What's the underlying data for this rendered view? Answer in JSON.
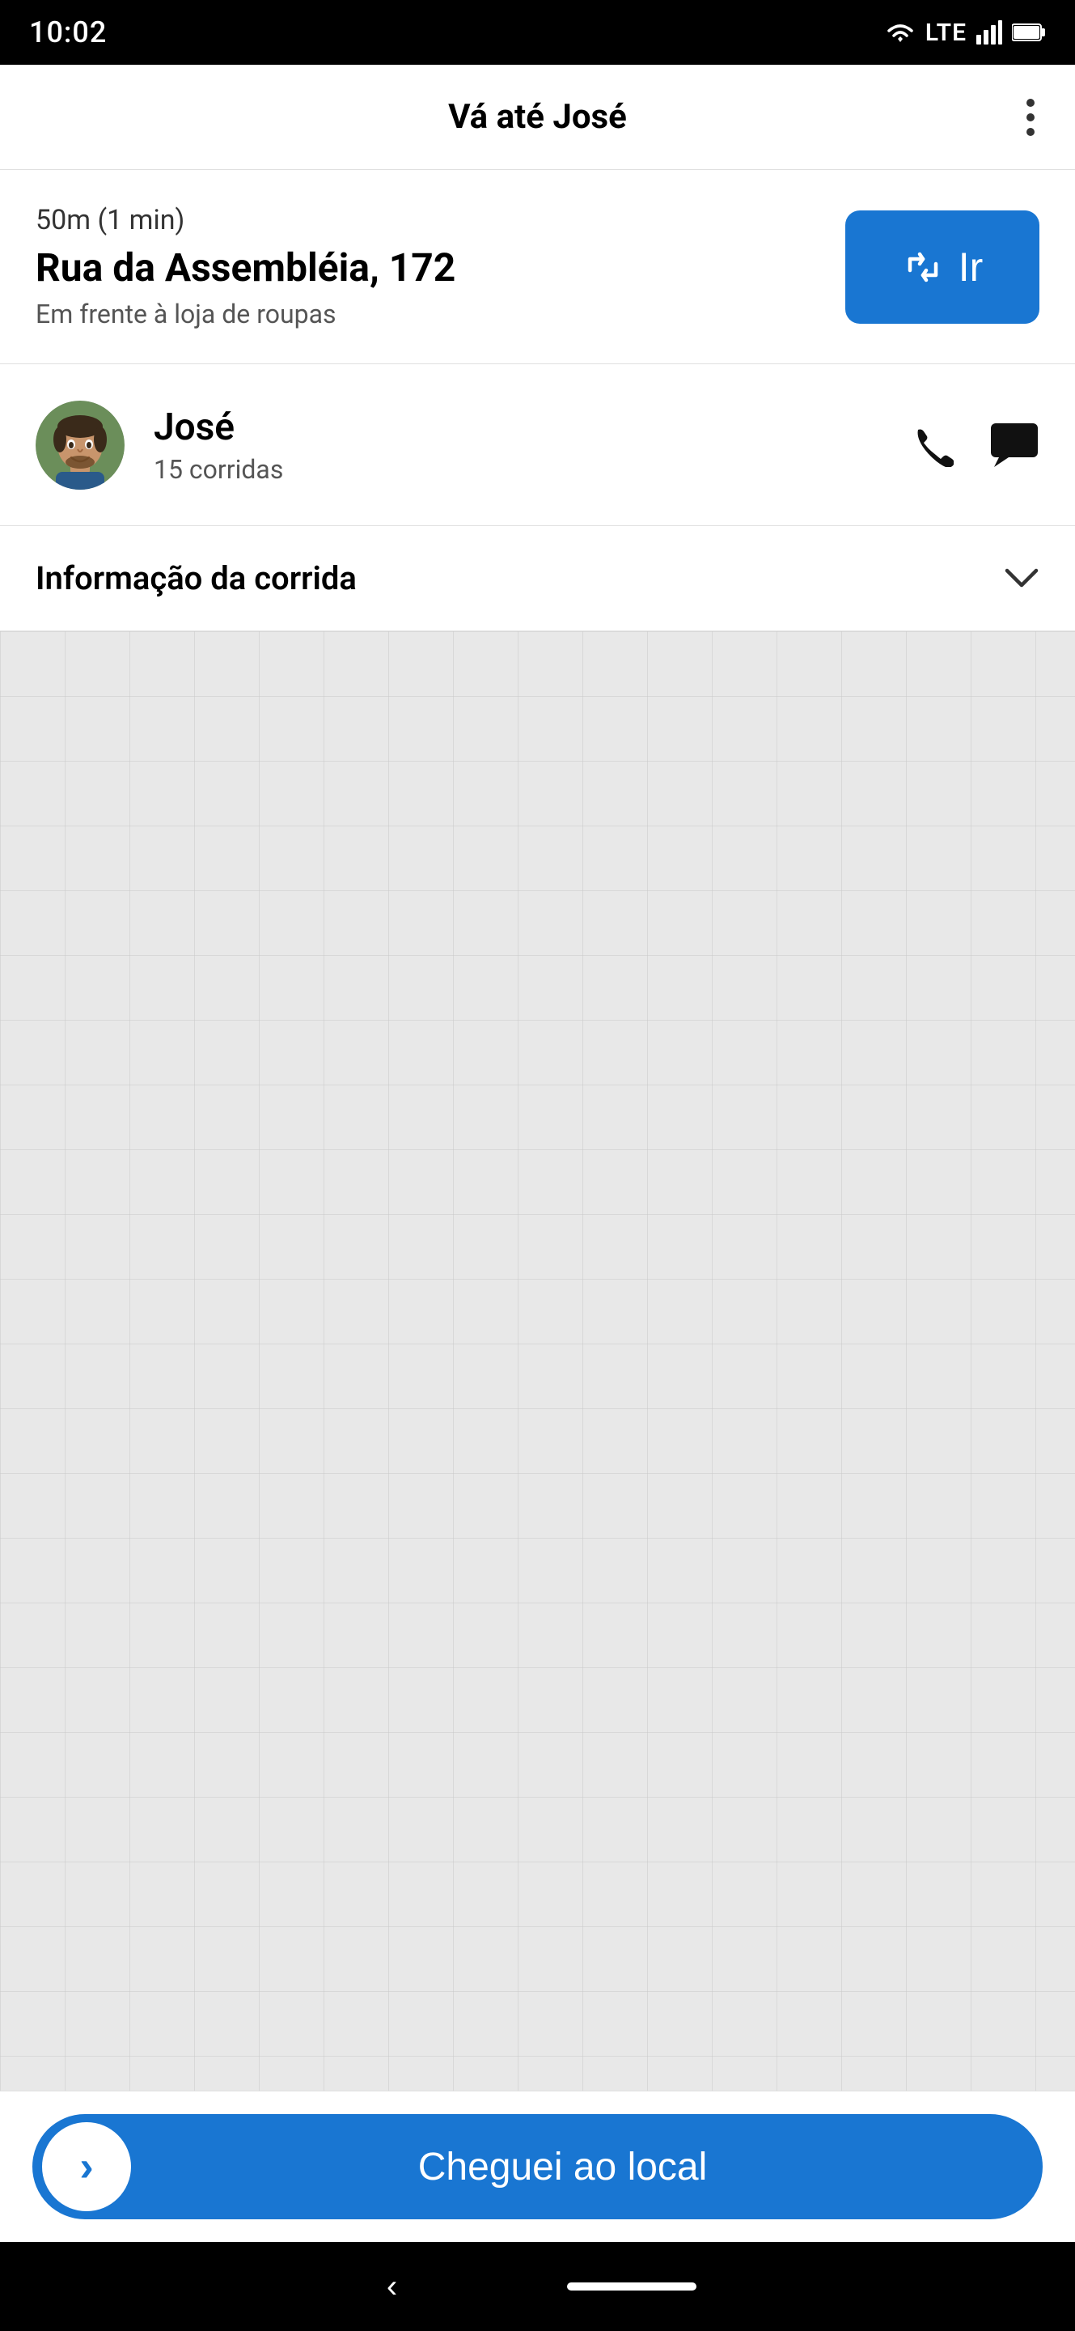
{
  "statusBar": {
    "time": "10:02",
    "lteLabel": "LTE"
  },
  "toolbar": {
    "title": "Vá até José",
    "menuIcon": "⋮"
  },
  "navigation": {
    "distance": "50m (1 min)",
    "address": "Rua da Assembléia, 172",
    "landmark": "Em frente à loja de roupas",
    "goButtonLabel": "Ir"
  },
  "passenger": {
    "name": "José",
    "ridesLabel": "15 corridas"
  },
  "rideInfo": {
    "label": "Informação da corrida"
  },
  "arrivedButton": {
    "label": "Cheguei ao local"
  }
}
